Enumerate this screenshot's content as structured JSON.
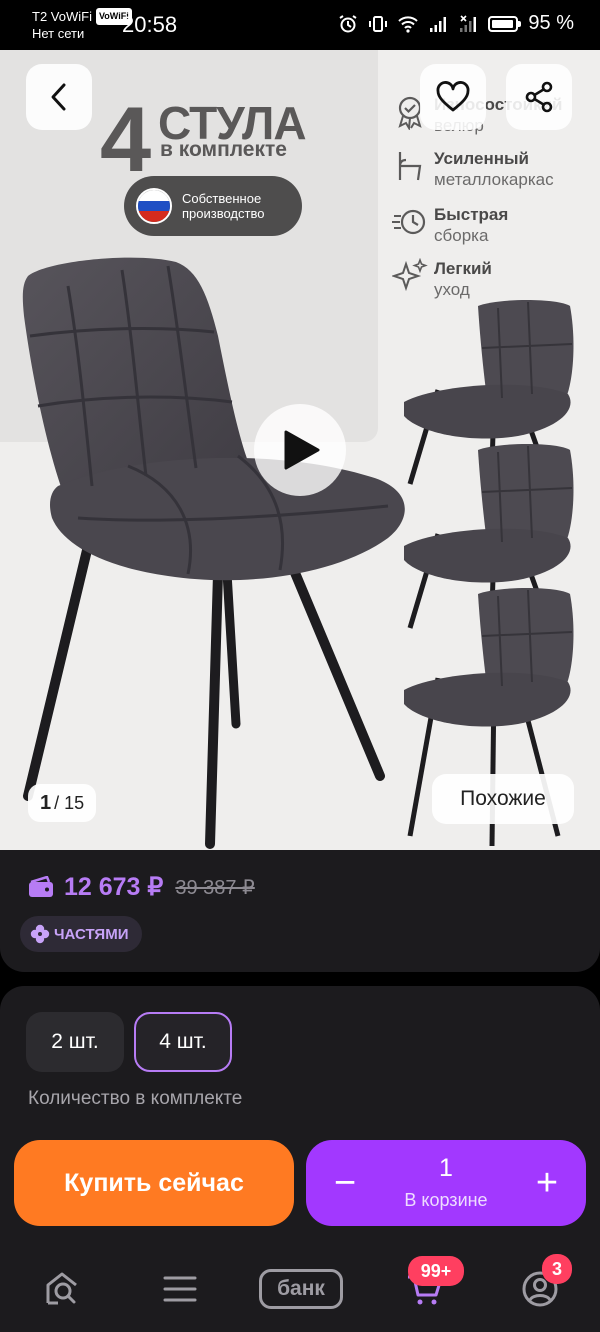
{
  "status_bar": {
    "carrier": "T2 VoWiFi",
    "volte_tag": "VoWiFi",
    "network": "Нет сети",
    "time": "20:58",
    "battery": "95 %"
  },
  "gallery": {
    "promo_number": "4",
    "promo_title": "СТУЛА",
    "promo_subtitle": "в комплекте",
    "made_in_badge": [
      "Собственное",
      "производство"
    ],
    "features": [
      {
        "icon": "award-icon",
        "line1": "Износостойкий",
        "line2": "велюр"
      },
      {
        "icon": "chair-frame-icon",
        "line1": "Усиленный",
        "line2": "металлокаркас"
      },
      {
        "icon": "fast-assembly-icon",
        "line1": "Быстрая",
        "line2": "сборка"
      },
      {
        "icon": "sparkle-icon",
        "line1": "Легкий",
        "line2": "уход"
      }
    ],
    "counter_current": "1",
    "counter_total": "/ 15",
    "similar_label": "Похожие"
  },
  "price": {
    "current": "12 673 ₽",
    "old": "39 387 ₽",
    "installments_label": "ЧАСТЯМИ"
  },
  "options": {
    "qty_options": [
      "2 шт.",
      "4 шт."
    ],
    "selected_index": 1,
    "kit_label": "Количество в комплекте",
    "buy_label": "Купить сейчас",
    "cart_count": "1",
    "cart_label": "В корзине",
    "minus": "−",
    "plus": "+"
  },
  "tabbar": {
    "bank_label": "банк",
    "cart_badge": "99+",
    "profile_badge": "3"
  },
  "colors": {
    "accent_purple": "#a238ff",
    "price_purple": "#b77cf5",
    "buy_orange": "#ff7a22",
    "badge_red": "#ff3f60",
    "card_bg": "#1c1b1e"
  }
}
